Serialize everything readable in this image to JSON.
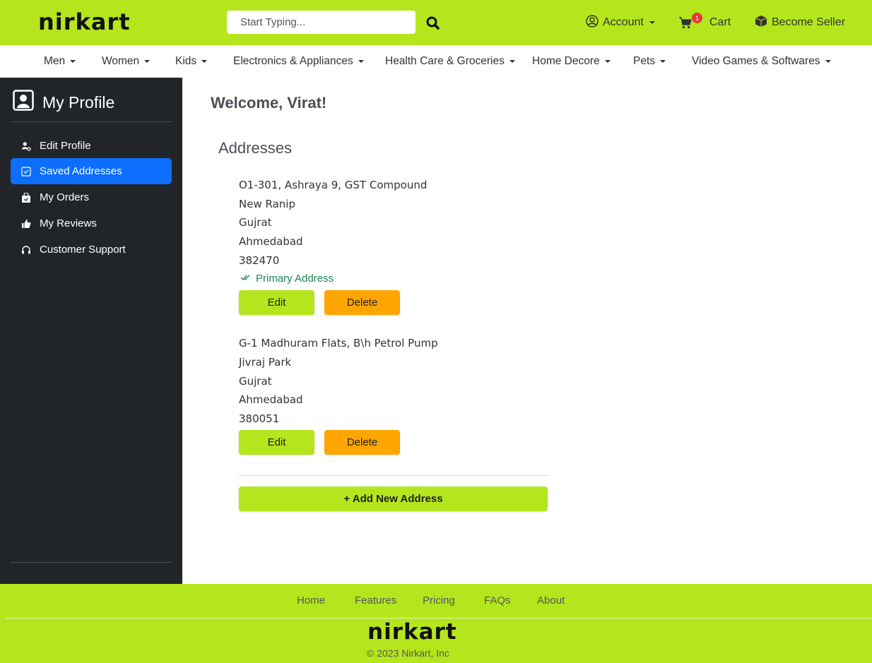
{
  "header": {
    "logo": "nirkart",
    "search_placeholder": "Start Typing...",
    "account_label": "Account",
    "cart_label": "Cart",
    "cart_count": "1",
    "seller_label": "Become Seller"
  },
  "categories": [
    "Men",
    "Women",
    "Kids",
    "Electronics & Appliances",
    "Health Care & Groceries",
    "Home Decore",
    "Pets",
    "Video Games & Softwares"
  ],
  "sidebar": {
    "title": "My Profile",
    "items": [
      {
        "label": "Edit Profile",
        "icon": "user-gear-icon"
      },
      {
        "label": "Saved Addresses",
        "icon": "address-card-icon"
      },
      {
        "label": "My Orders",
        "icon": "shopping-bag-icon"
      },
      {
        "label": "My Reviews",
        "icon": "thumbs-up-icon"
      },
      {
        "label": "Customer Support",
        "icon": "headset-icon"
      }
    ],
    "active_index": 1
  },
  "main": {
    "welcome": "Welcome, Virat!",
    "section_title": "Addresses",
    "addresses": [
      {
        "lines": [
          "O1-301, Ashraya 9, GST Compound",
          "New Ranip",
          "Gujrat",
          "Ahmedabad",
          "382470"
        ],
        "primary_label": "Primary Address"
      },
      {
        "lines": [
          "G-1 Madhuram Flats, B\\h Petrol Pump",
          "Jivraj Park",
          "Gujrat",
          "Ahmedabad",
          "380051"
        ]
      }
    ],
    "edit_label": "Edit",
    "delete_label": "Delete",
    "add_label": "+ Add New Address"
  },
  "footer": {
    "links": [
      "Home",
      "Features",
      "Pricing",
      "FAQs",
      "About"
    ],
    "logo": "nirkart",
    "copyright": "© 2023 Nirkart, Inc"
  },
  "colors": {
    "brand_lime": "#b5e61d",
    "sidebar_bg": "#212529",
    "active_blue": "#0d6efd",
    "delete_orange": "#ffa500",
    "primary_green": "#198754",
    "badge_red": "#e53935"
  }
}
